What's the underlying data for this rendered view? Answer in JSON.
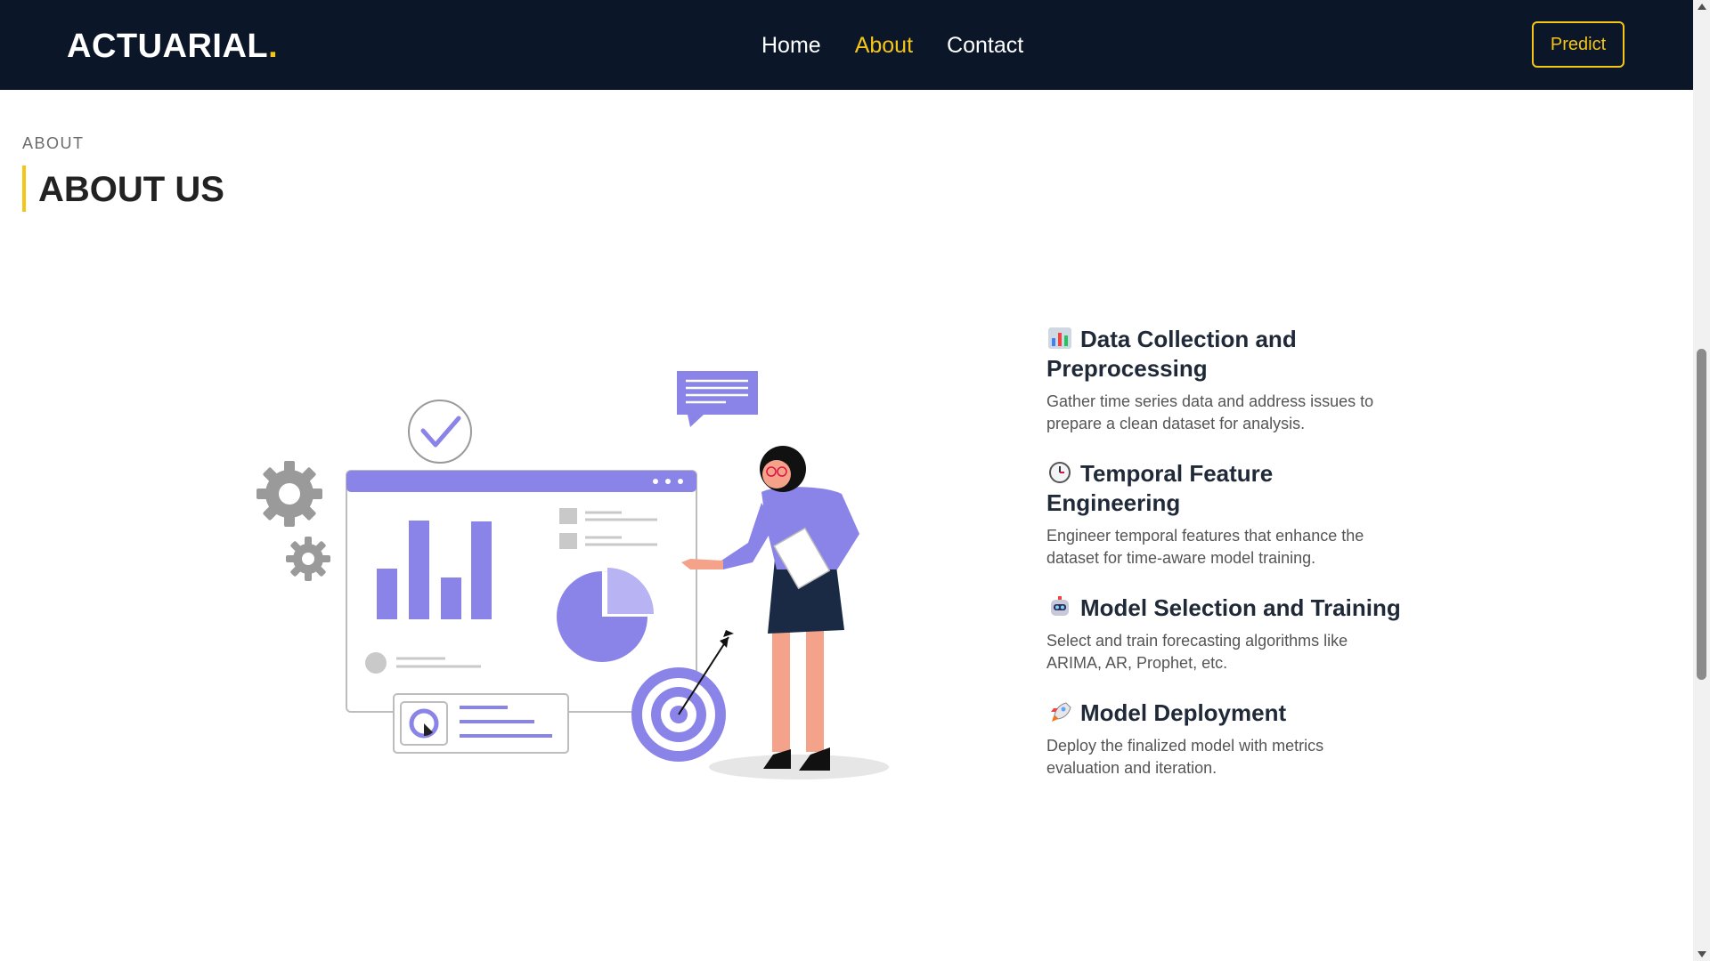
{
  "navbar": {
    "logo_text": "ACTUARIAL",
    "logo_dot": ".",
    "links": [
      {
        "label": "Home",
        "active": false
      },
      {
        "label": "About",
        "active": true
      },
      {
        "label": "Contact",
        "active": false
      }
    ],
    "predict_label": "Predict"
  },
  "colors": {
    "navbar_bg": "#0b1628",
    "accent": "#f5c518",
    "illustration_purple": "#8b84e8"
  },
  "about": {
    "section_label": "ABOUT",
    "title": "ABOUT US"
  },
  "features": [
    {
      "icon": "bar-chart-icon",
      "title": "Data Collection and Preprocessing",
      "description": "Gather time series data and address issues to prepare a clean dataset for analysis."
    },
    {
      "icon": "clock-icon",
      "title": "Temporal Feature Engineering",
      "description": "Engineer temporal features that enhance the dataset for time-aware model training."
    },
    {
      "icon": "robot-icon",
      "title": "Model Selection and Training",
      "description": "Select and train forecasting algorithms like ARIMA, AR, Prophet, etc."
    },
    {
      "icon": "rocket-icon",
      "title": "Model Deployment",
      "description": "Deploy the finalized model with metrics evaluation and iteration."
    }
  ]
}
